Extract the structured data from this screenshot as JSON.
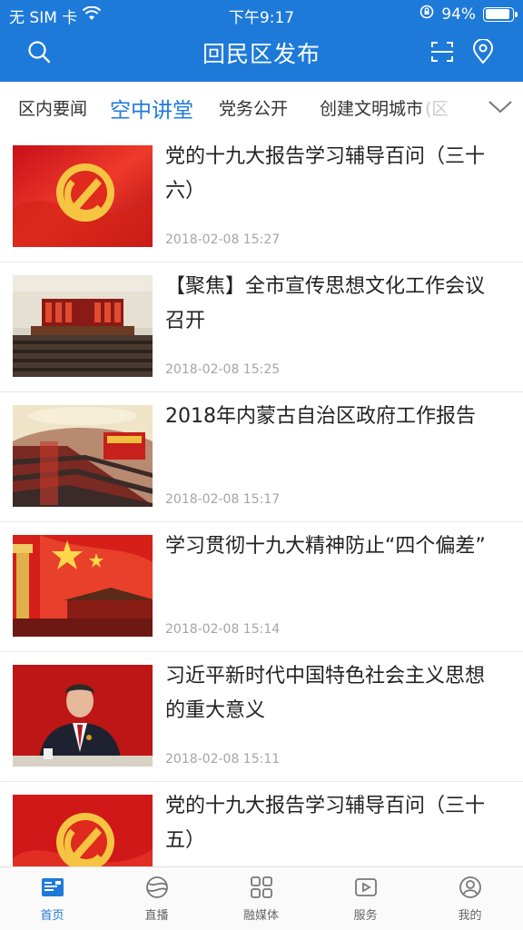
{
  "status_bar": {
    "carrier": "无 SIM 卡",
    "time": "下午9:17",
    "battery_text": "94%",
    "battery_level": 0.94
  },
  "header": {
    "title": "回民区发布",
    "left_icon": "search-icon",
    "right_icons": [
      "scan-icon",
      "location-icon"
    ]
  },
  "tabs": [
    {
      "label": "区内要闻",
      "active": false
    },
    {
      "label": "空中讲堂",
      "active": true
    },
    {
      "label": "党务公开",
      "active": false
    },
    {
      "label": "创建文明城市",
      "active": false
    },
    {
      "label": "(区",
      "active": false
    }
  ],
  "tabs_more_icon": "chevron-down-icon",
  "news": [
    {
      "title": "党的十九大报告学习辅导百问（三十六）",
      "time": "2018-02-08 15:27",
      "thumb": "party-emblem-flag"
    },
    {
      "title": "【聚焦】全市宣传思想文化工作会议召开",
      "time": "2018-02-08 15:25",
      "thumb": "conference-hall"
    },
    {
      "title": "2018年内蒙古自治区政府工作报告",
      "time": "2018-02-08 15:17",
      "thumb": "assembly-hall"
    },
    {
      "title": "学习贯彻十九大精神防止“四个偏差”",
      "time": "2018-02-08 15:14",
      "thumb": "national-flag-pillar"
    },
    {
      "title": "习近平新时代中国特色社会主义思想的重大意义",
      "time": "2018-02-08 15:11",
      "thumb": "speaker-portrait"
    },
    {
      "title": "党的十九大报告学习辅导百问（三十五）",
      "time": "",
      "thumb": "party-emblem-flag"
    }
  ],
  "bottom_nav": [
    {
      "label": "首页",
      "icon": "home-news-icon",
      "active": true
    },
    {
      "label": "直播",
      "icon": "live-globe-icon",
      "active": false
    },
    {
      "label": "融媒体",
      "icon": "grid-media-icon",
      "active": false
    },
    {
      "label": "服务",
      "icon": "play-service-icon",
      "active": false
    },
    {
      "label": "我的",
      "icon": "profile-icon",
      "active": false
    }
  ],
  "colors": {
    "brand_blue": "#1e7ad9",
    "time_gray": "#a5a5a5"
  }
}
